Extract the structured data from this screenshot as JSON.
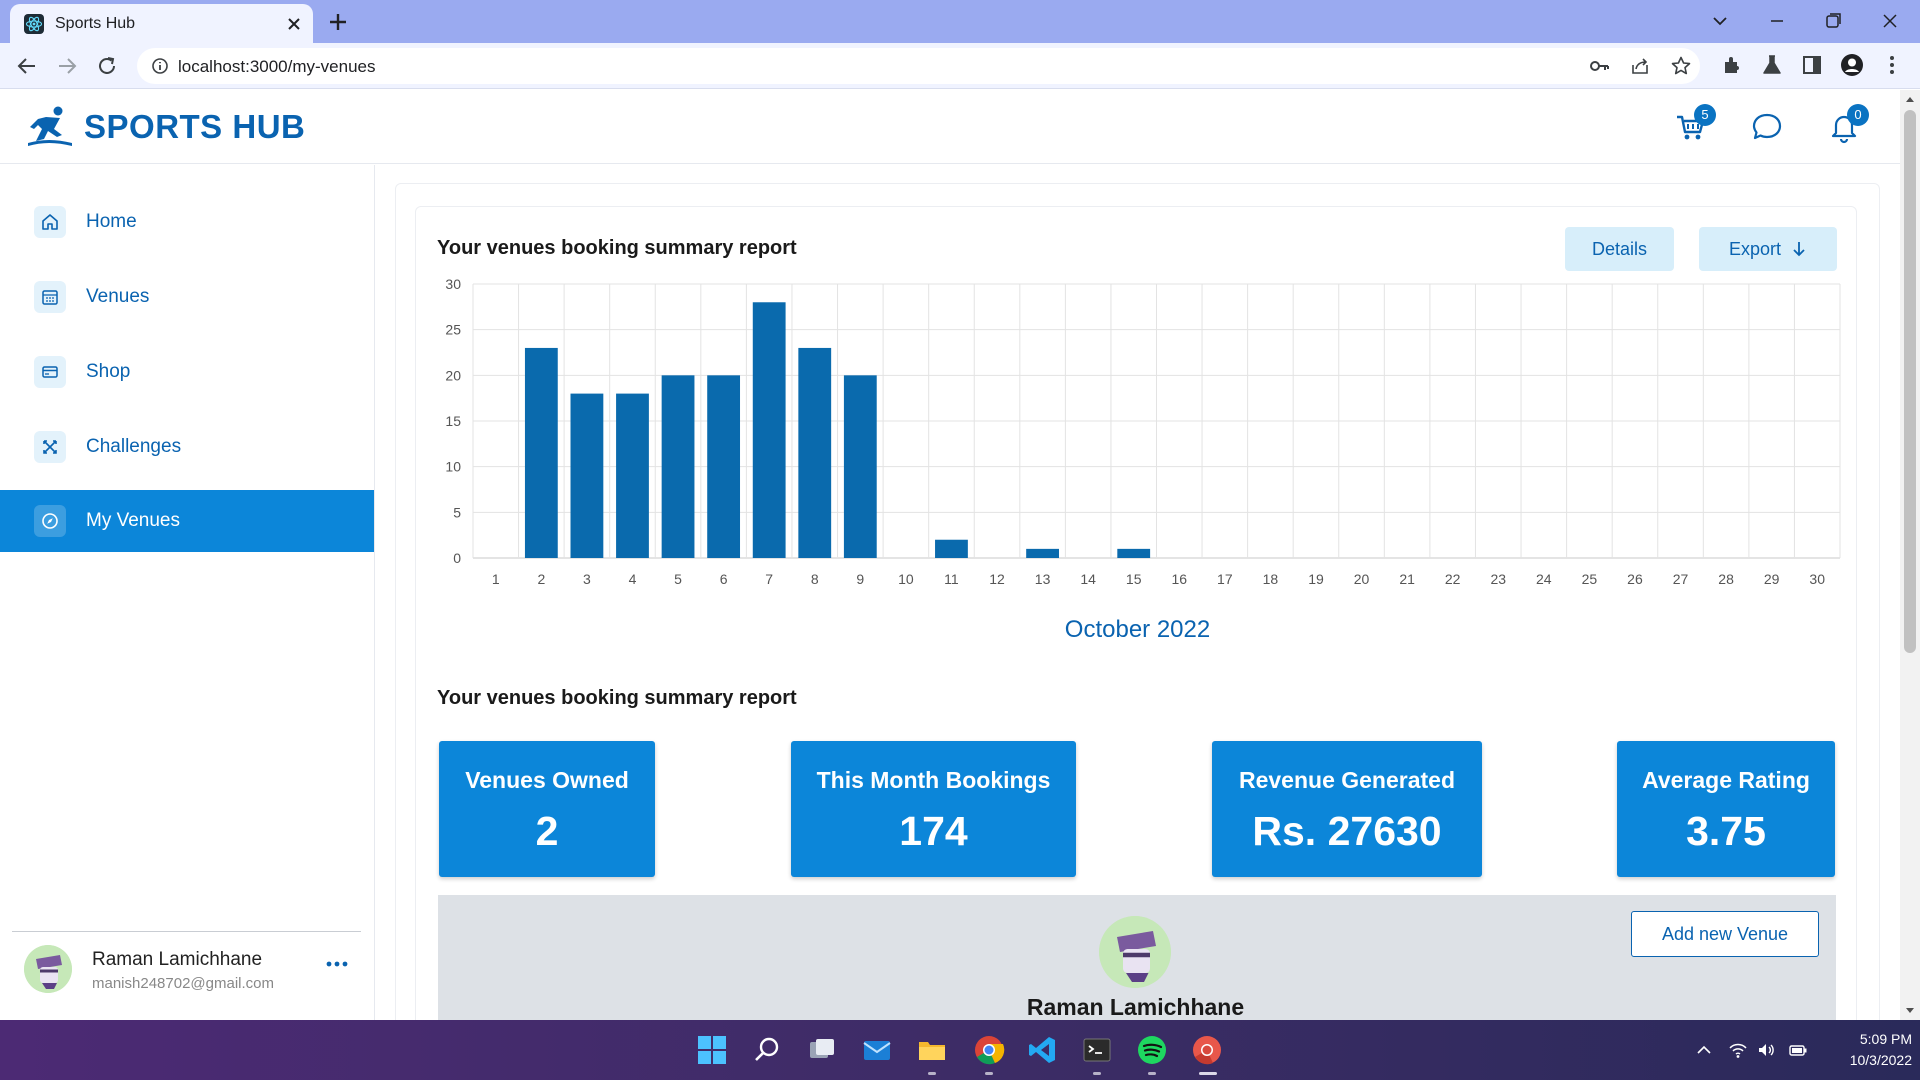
{
  "browser": {
    "tab_title": "Sports Hub",
    "url": "localhost:3000/my-venues"
  },
  "header": {
    "brand": "SPORTS HUB",
    "cart_count": "5",
    "notification_count": "0"
  },
  "sidebar": {
    "items": [
      {
        "label": "Home",
        "icon": "home-icon"
      },
      {
        "label": "Venues",
        "icon": "calendar-icon"
      },
      {
        "label": "Shop",
        "icon": "card-icon"
      },
      {
        "label": "Challenges",
        "icon": "crossed-swords-icon"
      },
      {
        "label": "My Venues",
        "icon": "compass-icon",
        "active": true
      }
    ],
    "profile": {
      "name": "Raman Lamichhane",
      "email": "manish248702@gmail.com"
    }
  },
  "main": {
    "chart_title": "Your venues booking summary report",
    "details_label": "Details",
    "export_label": "Export",
    "summary_title": "Your venues booking summary report",
    "stats": [
      {
        "label": "Venues Owned",
        "value": "2"
      },
      {
        "label": "This Month Bookings",
        "value": "174"
      },
      {
        "label": "Revenue Generated",
        "value": "Rs. 27630"
      },
      {
        "label": "Average Rating",
        "value": "3.75"
      }
    ],
    "venue_owner": "Raman Lamichhane",
    "add_venue_label": "Add new Venue"
  },
  "taskbar": {
    "time": "5:09 PM",
    "date": "10/3/2022"
  },
  "colors": {
    "accent": "#0c86d9",
    "brand": "#0a63b0",
    "bar": "#0a6aad"
  },
  "chart_data": {
    "type": "bar",
    "xlabel": "October 2022",
    "ylim": [
      0,
      30
    ],
    "yticks": [
      0,
      5,
      10,
      15,
      20,
      25,
      30
    ],
    "grid": true,
    "categories": [
      "1",
      "2",
      "3",
      "4",
      "5",
      "6",
      "7",
      "8",
      "9",
      "10",
      "11",
      "12",
      "13",
      "14",
      "15",
      "16",
      "17",
      "18",
      "19",
      "20",
      "21",
      "22",
      "23",
      "24",
      "25",
      "26",
      "27",
      "28",
      "29",
      "30"
    ],
    "values": [
      0,
      23,
      18,
      18,
      20,
      20,
      28,
      23,
      20,
      0,
      2,
      0,
      1,
      0,
      1,
      0,
      0,
      0,
      0,
      0,
      0,
      0,
      0,
      0,
      0,
      0,
      0,
      0,
      0,
      0
    ]
  }
}
